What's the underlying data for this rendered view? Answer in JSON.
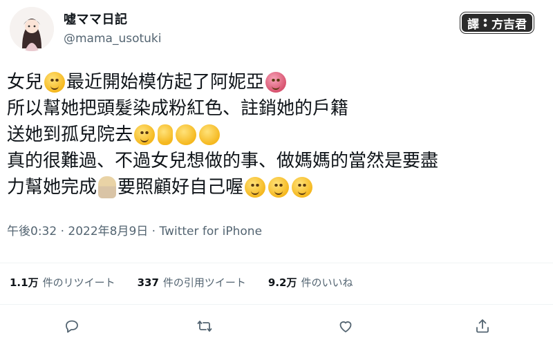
{
  "profile": {
    "display_name": "噓ママ日記",
    "handle": "@mama_usotuki"
  },
  "watermark": {
    "badge_left": "譯",
    "badge_right": "方吉君"
  },
  "tweet": {
    "lines": [
      {
        "before": "女兒",
        "after1": "最近開始模仿起了阿妮亞",
        "after2": ""
      },
      {
        "before": "所以幫她把頭髮染成粉紅色、註銷她的戶籍",
        "after1": "",
        "after2": ""
      },
      {
        "before": "送她到孤兒院去",
        "after1": "",
        "after2": ""
      },
      {
        "before": "真的很難過、不過女兒想做的事、做媽媽的當然是要盡",
        "after1": "",
        "after2": ""
      },
      {
        "before": "力幫她完成",
        "after1": "要照顧好自己喔",
        "after2": ""
      }
    ],
    "emoji": {
      "line1_a": "woman-emoji",
      "line1_b": "sick-face-emoji",
      "line3": [
        "relieved-face-emoji",
        "hand-emoji",
        "clapping-hands-emoji",
        "clapping-hands-emoji"
      ],
      "line5_a": "woman-shrugging-emoji",
      "line5_b": [
        "smiling-face-emoji",
        "worried-face-emoji",
        "laughing-tears-emoji"
      ]
    }
  },
  "meta": {
    "text": "午後0:32 · 2022年8月9日 · Twitter for iPhone"
  },
  "stats": [
    {
      "count": "1.1万",
      "label": "件のリツイート"
    },
    {
      "count": "337",
      "label": "件の引用ツイート"
    },
    {
      "count": "9.2万",
      "label": "件のいいね"
    }
  ],
  "colors": {
    "text": "#0f1419",
    "secondary": "#536471",
    "divider": "#eff3f4"
  },
  "actions": [
    "reply-icon",
    "retweet-icon",
    "like-icon",
    "share-icon"
  ]
}
